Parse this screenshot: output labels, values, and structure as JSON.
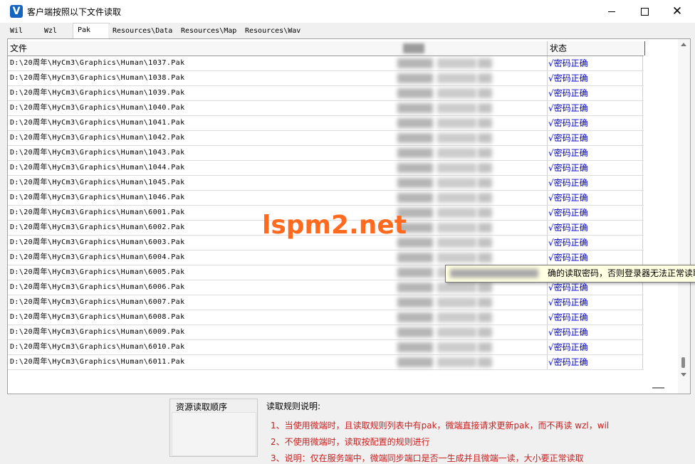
{
  "window": {
    "title": "客户端按照以下文件读取",
    "icon_letter": "V",
    "close_glyph": "✕"
  },
  "tabs": [
    {
      "label": "Wil",
      "active": false
    },
    {
      "label": "Wzl",
      "active": false
    },
    {
      "label": "Pak",
      "active": true
    },
    {
      "label": "Resources\\Data",
      "active": false
    },
    {
      "label": "Resources\\Map",
      "active": false
    },
    {
      "label": "Resources\\Wav",
      "active": false
    }
  ],
  "table": {
    "headers": {
      "file": "文件",
      "status": "状态"
    },
    "rows": [
      {
        "path": "D:\\20周年\\HyCm3\\Graphics\\Human\\1037.Pak",
        "status": "√密码正确"
      },
      {
        "path": "D:\\20周年\\HyCm3\\Graphics\\Human\\1038.Pak",
        "status": "√密码正确"
      },
      {
        "path": "D:\\20周年\\HyCm3\\Graphics\\Human\\1039.Pak",
        "status": "√密码正确"
      },
      {
        "path": "D:\\20周年\\HyCm3\\Graphics\\Human\\1040.Pak",
        "status": "√密码正确"
      },
      {
        "path": "D:\\20周年\\HyCm3\\Graphics\\Human\\1041.Pak",
        "status": "√密码正确"
      },
      {
        "path": "D:\\20周年\\HyCm3\\Graphics\\Human\\1042.Pak",
        "status": "√密码正确"
      },
      {
        "path": "D:\\20周年\\HyCm3\\Graphics\\Human\\1043.Pak",
        "status": "√密码正确"
      },
      {
        "path": "D:\\20周年\\HyCm3\\Graphics\\Human\\1044.Pak",
        "status": "√密码正确"
      },
      {
        "path": "D:\\20周年\\HyCm3\\Graphics\\Human\\1045.Pak",
        "status": "√密码正确"
      },
      {
        "path": "D:\\20周年\\HyCm3\\Graphics\\Human\\1046.Pak",
        "status": "√密码正确"
      },
      {
        "path": "D:\\20周年\\HyCm3\\Graphics\\Human\\6001.Pak",
        "status": "√密码正确"
      },
      {
        "path": "D:\\20周年\\HyCm3\\Graphics\\Human\\6002.Pak",
        "status": "√密码正确"
      },
      {
        "path": "D:\\20周年\\HyCm3\\Graphics\\Human\\6003.Pak",
        "status": "√密码正确"
      },
      {
        "path": "D:\\20周年\\HyCm3\\Graphics\\Human\\6004.Pak",
        "status": "√密码正确"
      },
      {
        "path": "D:\\20周年\\HyCm3\\Graphics\\Human\\6005.Pak",
        "status": ""
      },
      {
        "path": "D:\\20周年\\HyCm3\\Graphics\\Human\\6006.Pak",
        "status": "√密码正确"
      },
      {
        "path": "D:\\20周年\\HyCm3\\Graphics\\Human\\6007.Pak",
        "status": "√密码正确"
      },
      {
        "path": "D:\\20周年\\HyCm3\\Graphics\\Human\\6008.Pak",
        "status": "√密码正确"
      },
      {
        "path": "D:\\20周年\\HyCm3\\Graphics\\Human\\6009.Pak",
        "status": "√密码正确"
      },
      {
        "path": "D:\\20周年\\HyCm3\\Graphics\\Human\\6010.Pak",
        "status": "√密码正确"
      },
      {
        "path": "D:\\20周年\\HyCm3\\Graphics\\Human\\6011.Pak",
        "status": "√密码正确"
      }
    ]
  },
  "tooltip": {
    "text": "确的读取密码，否则登录器无法正常读取"
  },
  "watermark": "lspm2.net",
  "bottom": {
    "order_label": "资源读取顺序",
    "rules_title": "读取规则说明:",
    "rules": [
      "1、当使用微端时，且读取规则列表中有pak，微端直接请求更新pak，而不再读 wzl，wil",
      "2、不使用微端时，读取按配置的规则进行",
      "3、说明：仅在服务端中，微端同步端口是否一生成并且微端一读，大小要正常读取"
    ]
  },
  "colors": {
    "status_text": "#0000c8",
    "rules_text": "#c81e1e",
    "watermark": "#ff6a1f",
    "tooltip_bg": "#ffffe1"
  }
}
